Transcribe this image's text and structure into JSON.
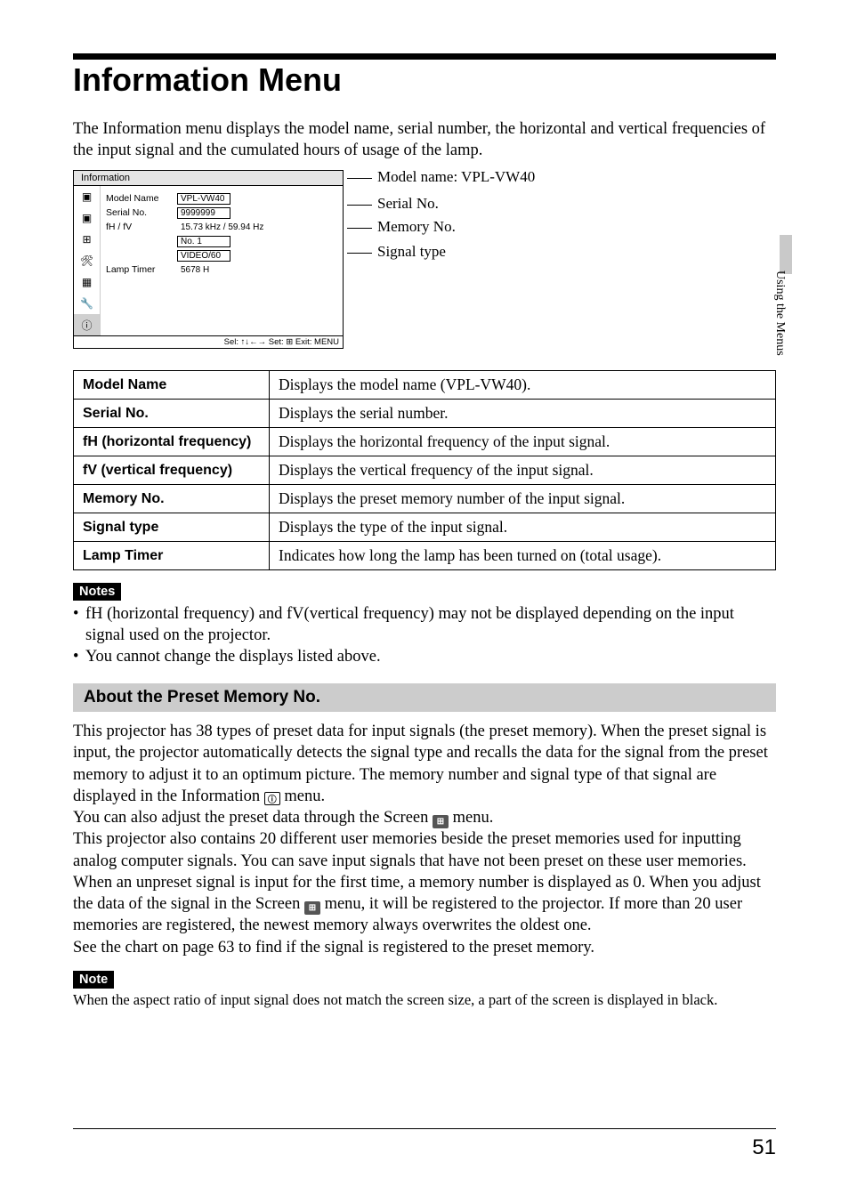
{
  "title": "Information Menu",
  "intro": "The Information menu displays the model name, serial number, the horizontal and vertical frequencies of the input signal and the cumulated hours of usage of the lamp.",
  "side_tab": "Using the Menus",
  "osd": {
    "window_title": "Information",
    "rows": {
      "model_name_label": "Model Name",
      "model_name_value": "VPL-VW40",
      "serial_label": "Serial No.",
      "serial_value": "9999999",
      "fhfv_label": "fH / fV",
      "fhfv_value": "15.73 kHz / 59.94 Hz",
      "memory_value": "No. 1",
      "signal_value": "VIDEO/60",
      "lamp_label": "Lamp Timer",
      "lamp_value": "5678 H"
    },
    "footer": "Sel: ↑↓←→   Set: ⊞   Exit: MENU"
  },
  "callouts": {
    "c1": "Model name: VPL-VW40",
    "c2": "Serial No.",
    "c3": "Memory No.",
    "c4": "Signal type"
  },
  "table": [
    {
      "key": "Model Name",
      "val": "Displays the model name (VPL-VW40)."
    },
    {
      "key": "Serial No.",
      "val": "Displays the serial number."
    },
    {
      "key": "fH (horizontal frequency)",
      "val": "Displays the horizontal frequency of the input signal."
    },
    {
      "key": "fV (vertical frequency)",
      "val": "Displays the vertical frequency of the input signal."
    },
    {
      "key": "Memory No.",
      "val": "Displays the preset memory number of the input signal."
    },
    {
      "key": "Signal type",
      "val": "Displays the type of the input signal."
    },
    {
      "key": "Lamp Timer",
      "val": "Indicates how long the lamp has been turned on (total usage)."
    }
  ],
  "notes_label": "Notes",
  "notes": [
    "fH (horizontal frequency) and fV(vertical frequency) may not be displayed depending on the input signal used on the projector.",
    "You cannot change the displays listed above."
  ],
  "sub_heading": "About the Preset Memory No.",
  "body1_a": "This projector has 38 types of preset data for input signals (the preset memory). When the preset signal is input, the projector automatically detects the signal type and recalls the data for the signal from the preset memory to adjust it to an optimum picture. The memory number and signal type of that signal are displayed in the Information ",
  "body1_b": " menu.",
  "body2_a": "You can also adjust the preset data through the Screen ",
  "body2_b": " menu.",
  "body3": "This projector also contains 20 different user memories beside the preset memories used for inputting analog computer signals. You can save input signals that have not been preset on these user memories.",
  "body4_a": "When an unpreset signal is input for the first time, a memory number is displayed as 0. When you adjust the data of the signal in the Screen ",
  "body4_b": " menu, it will be registered to the projector. If more than 20 user memories are registered, the newest memory always overwrites the oldest one.",
  "body5": "See the chart on page 63 to find if the signal is registered to the preset memory.",
  "note2_label": "Note",
  "note2": "When the aspect ratio of input signal does not match the screen size, a part of the screen is displayed in black.",
  "icon_info_char": "ⓘ",
  "icon_screen_char": "⊞",
  "page_number": "51"
}
